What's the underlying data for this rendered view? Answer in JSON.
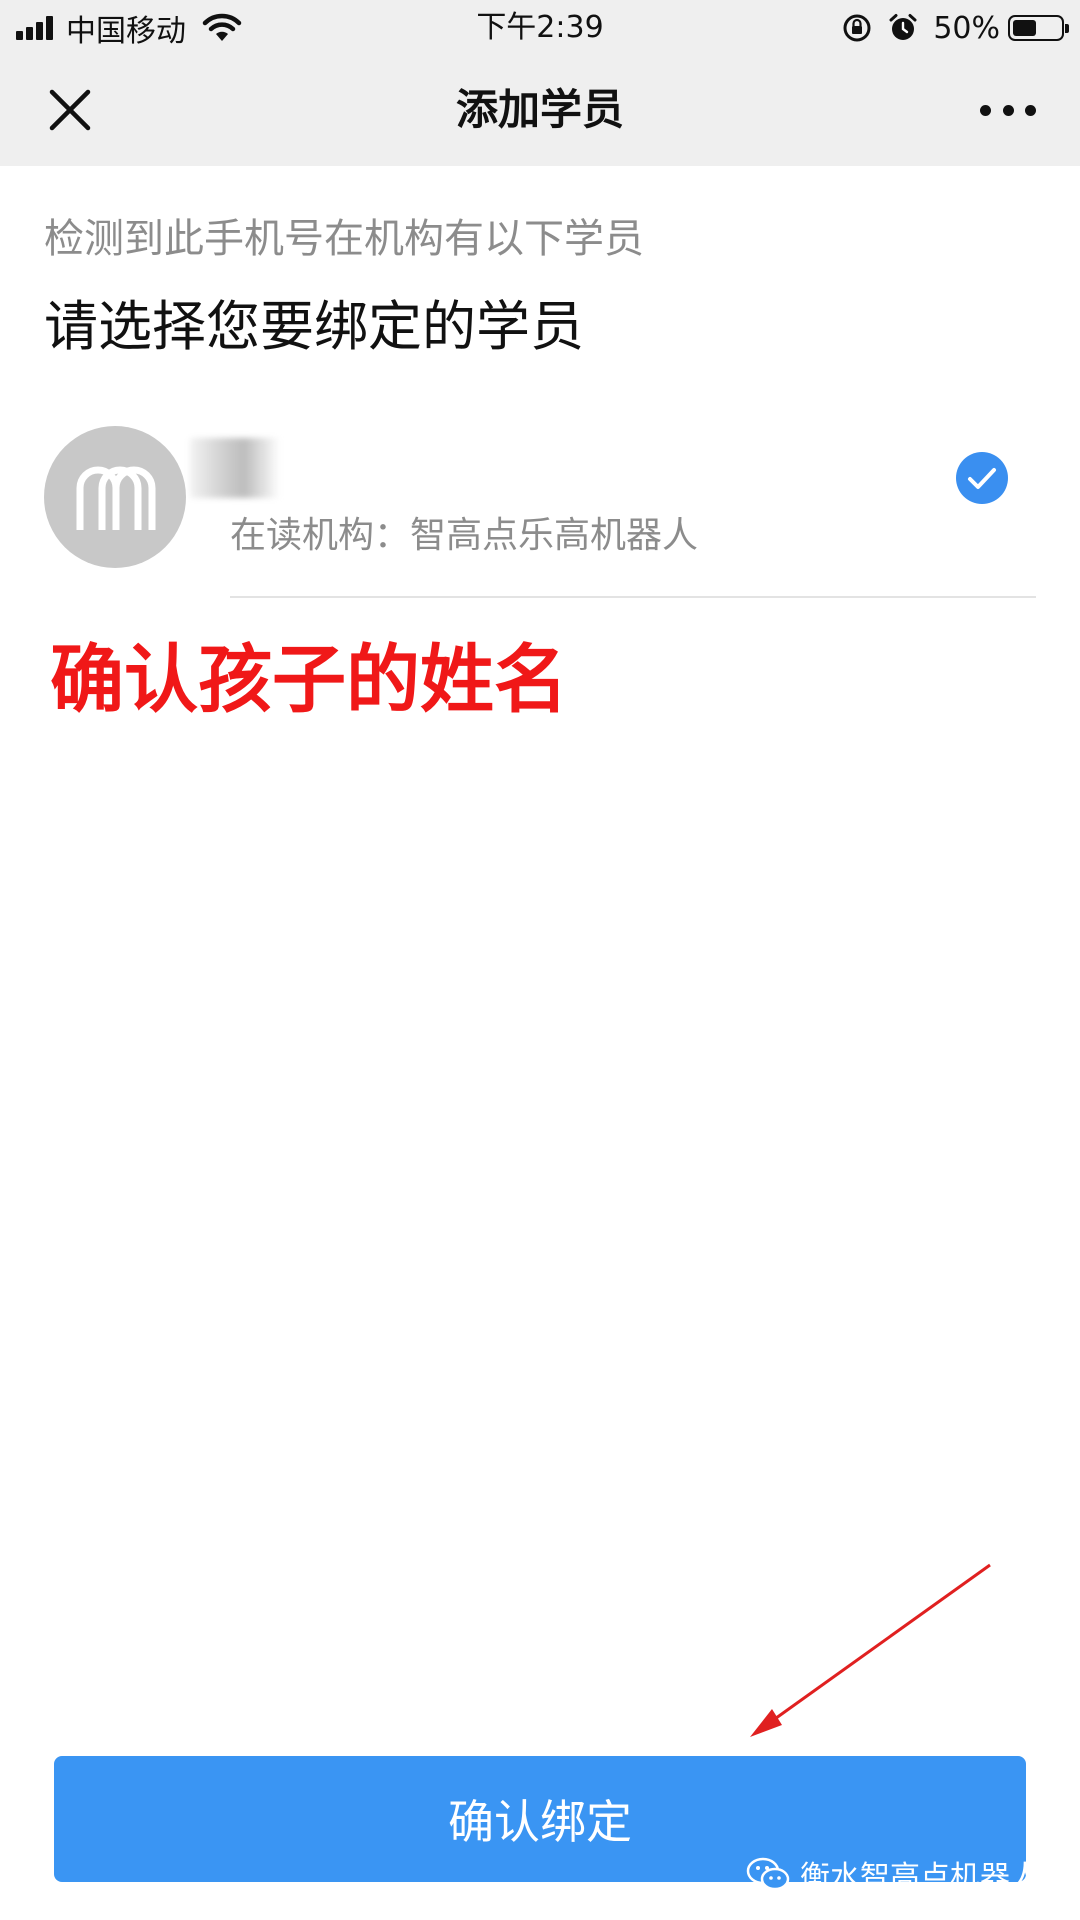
{
  "status_bar": {
    "carrier": "中国移动",
    "time": "下午2:39",
    "battery_percent": "50%",
    "battery_level": 0.5,
    "icons": [
      "signal-icon",
      "wifi-icon",
      "rotation-lock-icon",
      "alarm-icon",
      "battery-icon"
    ]
  },
  "nav": {
    "title": "添加学员",
    "close_icon": "close-icon",
    "more_icon": "more-icon"
  },
  "content": {
    "hint": "检测到此手机号在机构有以下学员",
    "prompt": "请选择您要绑定的学员",
    "students": [
      {
        "name": "",
        "school": "在读机构：智高点乐高机器人",
        "selected": true
      }
    ]
  },
  "annotation": {
    "text": "确认孩子的姓名",
    "color": "#f01818"
  },
  "footer": {
    "confirm_label": "确认绑定",
    "watermark": "衡水智高点机器人"
  },
  "colors": {
    "accent": "#3a95f3",
    "check": "#3a8ff0",
    "bar_bg": "#efefef"
  }
}
